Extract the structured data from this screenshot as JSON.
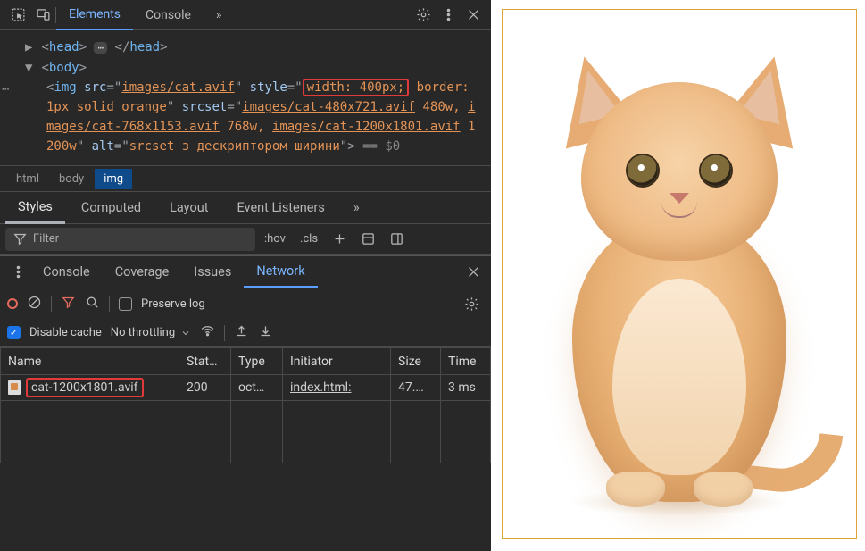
{
  "topbar": {
    "tabs": {
      "elements": "Elements",
      "console": "Console"
    },
    "more": "»"
  },
  "dom": {
    "head_open": "<head>",
    "head_close": "</head>",
    "body_open": "<body>",
    "img_tag": "img",
    "src_attr": "src",
    "src_val": "images/cat.avif",
    "style_attr": "style",
    "style_val_highlight": "width: 400px;",
    "style_val_rest": "border: 1px solid orange",
    "srcset_attr": "srcset",
    "srcset_link1": "images/cat-480x721.avif",
    "srcset_w1": "480w",
    "srcset_link2": "images/cat-768x1153.avif",
    "srcset_w2": "768w",
    "srcset_link3": "images/cat-1200x1801.avif",
    "srcset_w3": "1200w",
    "alt_attr": "alt",
    "alt_val": "srcset з дескриптором ширини",
    "eq_dollar": "== $0"
  },
  "breadcrumb": {
    "html": "html",
    "body": "body",
    "img": "img"
  },
  "styles_tabs": {
    "styles": "Styles",
    "computed": "Computed",
    "layout": "Layout",
    "listeners": "Event Listeners",
    "more": "»"
  },
  "filter": {
    "placeholder": "Filter",
    "hov": ":hov",
    "cls": ".cls"
  },
  "secondary": {
    "tabs": {
      "console": "Console",
      "coverage": "Coverage",
      "issues": "Issues",
      "network": "Network"
    },
    "preserve": "Preserve log",
    "disable_cache": "Disable cache",
    "throttling": "No throttling"
  },
  "network": {
    "headers": {
      "name": "Name",
      "status": "Stat…",
      "type": "Type",
      "initiator": "Initiator",
      "size": "Size",
      "time": "Time"
    },
    "rows": [
      {
        "name": "cat-1200x1801.avif",
        "status": "200",
        "type": "oct…",
        "initiator": "index.html:",
        "size": "47.…",
        "time": "3 ms"
      }
    ]
  }
}
